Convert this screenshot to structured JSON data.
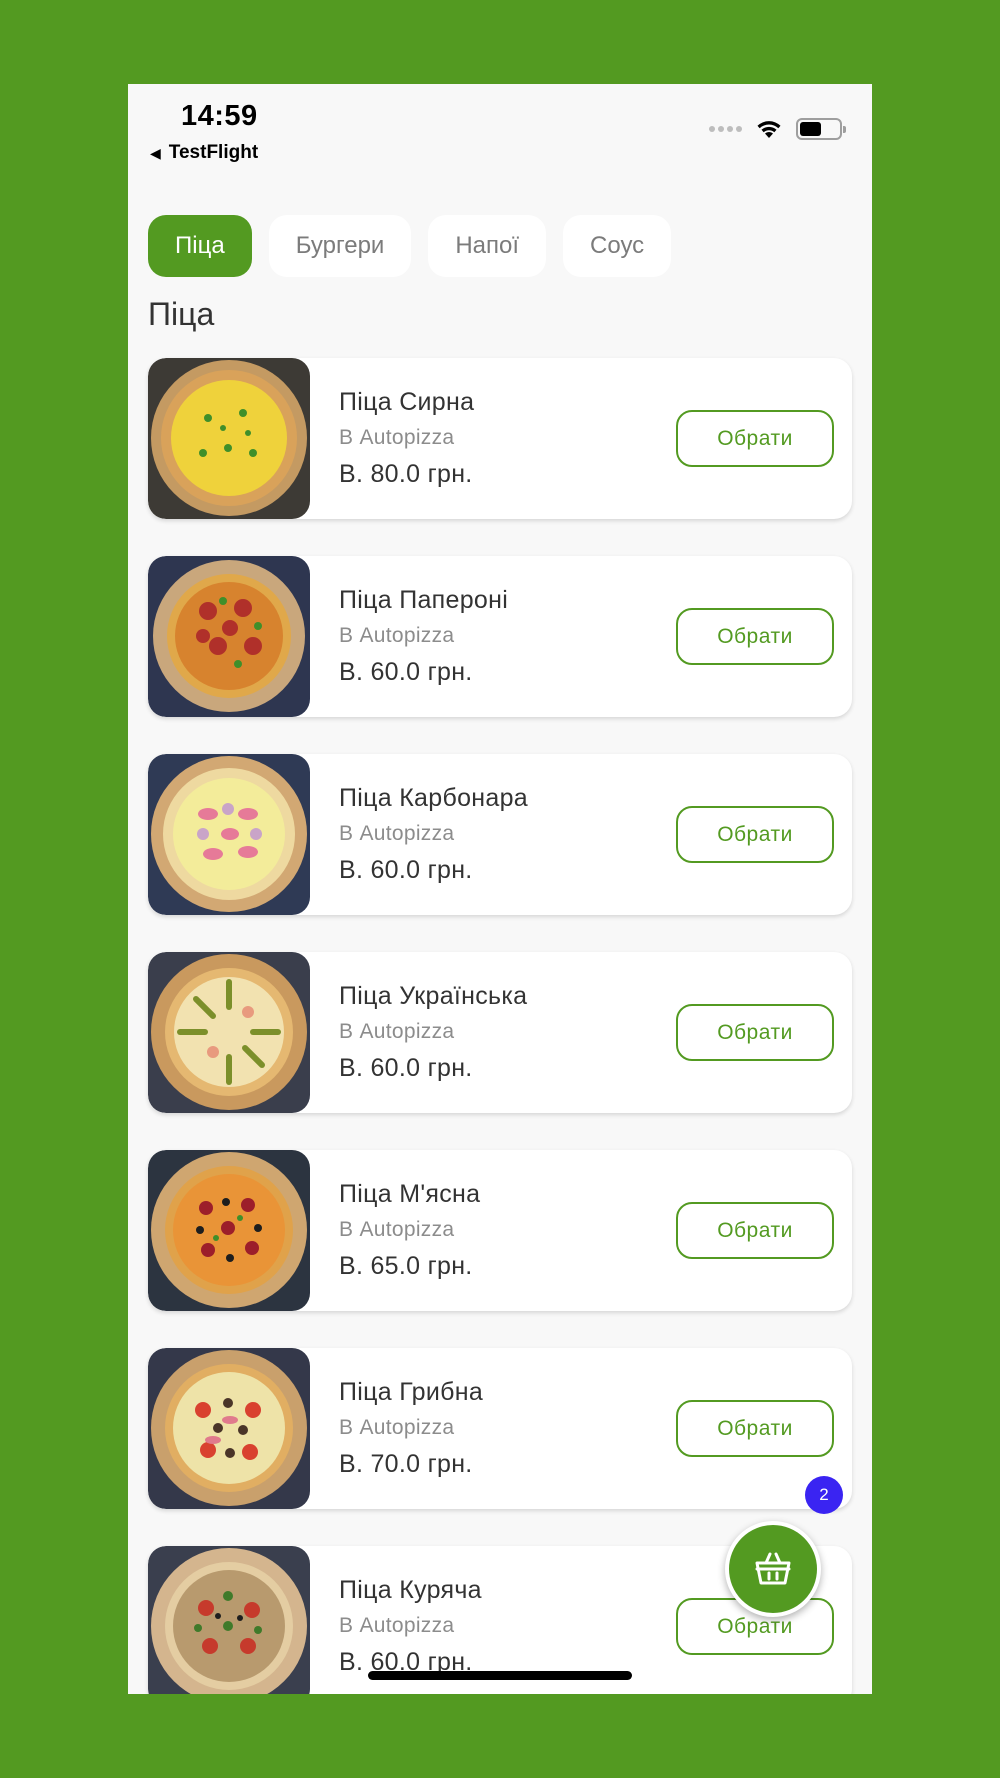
{
  "status_bar": {
    "time": "14:59",
    "back_label": "TestFlight",
    "battery_level": 0.55
  },
  "tabs": [
    {
      "label": "Піца",
      "active": true
    },
    {
      "label": "Бургери",
      "active": false
    },
    {
      "label": "Напої",
      "active": false
    },
    {
      "label": "Соус",
      "active": false
    }
  ],
  "section_title": "Піца",
  "products": [
    {
      "name": "Піца Сирна",
      "shop": "В Autopizza",
      "price": "В. 80.0 грн.",
      "button": "Обрати"
    },
    {
      "name": "Піца Папероні",
      "shop": "В Autopizza",
      "price": "В. 60.0 грн.",
      "button": "Обрати"
    },
    {
      "name": "Піца Карбонара",
      "shop": "В Autopizza",
      "price": "В. 60.0 грн.",
      "button": "Обрати"
    },
    {
      "name": "Піца Українська",
      "shop": "В Autopizza",
      "price": "В. 60.0 грн.",
      "button": "Обрати"
    },
    {
      "name": "Піца М'ясна",
      "shop": "В Autopizza",
      "price": "В. 65.0 грн.",
      "button": "Обрати"
    },
    {
      "name": "Піца Грибна",
      "shop": "В Autopizza",
      "price": "В. 70.0 грн.",
      "button": "Обрати"
    },
    {
      "name": "Піца Куряча",
      "shop": "В Autopizza",
      "price": "В. 60.0 грн.",
      "button": "Обрати"
    }
  ],
  "cart": {
    "icon": "basket-icon",
    "count": "2"
  },
  "colors": {
    "brand": "#539A21",
    "badge": "#3A24F2",
    "background": "#F8F8F8"
  }
}
